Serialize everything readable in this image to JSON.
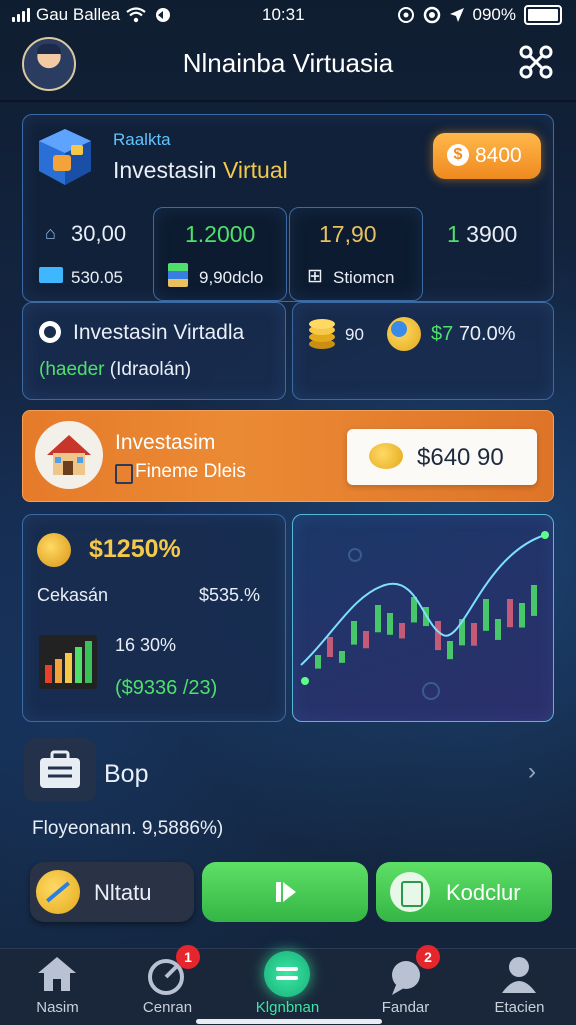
{
  "status_bar": {
    "carrier": "Gau Ballea",
    "time": "10:31",
    "battery": "090%"
  },
  "header": {
    "title": "Nlnainba Virtuasia"
  },
  "main_card": {
    "small_label": "Raalkta",
    "title_white": "Investasin ",
    "title_yellow": "Virtual",
    "badge_value": "8400",
    "stat1": "30,00",
    "stat2": "1.2000",
    "stat3": "17,90",
    "stat4": "1 3900",
    "sub1": "530.05",
    "sub2": "9,90dclo",
    "sub3": "Stiomcn"
  },
  "invest_card": {
    "title": "Investasin Virtadla",
    "sub_green": "(haeder",
    "sub_white": " (Idraolán)"
  },
  "coin_card": {
    "value1": "90",
    "value2": "$7 70.0%"
  },
  "orange_banner": {
    "title": "Investasim",
    "subtitle": "Fineme Dleis",
    "price": "$640 90"
  },
  "left_panel": {
    "amount": "$1250%",
    "label": "Cekasán",
    "label_value": "$535.%",
    "mid": "16 30%",
    "bottom": "($9336 /23)"
  },
  "section": {
    "title": "Bop",
    "subtitle": "Floyeonann. 9,5886%)"
  },
  "buttons": {
    "b1": "Nltatu",
    "b3": "Kodclur"
  },
  "nav": [
    {
      "label": "Nasim"
    },
    {
      "label": "Cenran",
      "badge": "1"
    },
    {
      "label": "Klgnbnan"
    },
    {
      "label": "Fandar",
      "badge": "2"
    },
    {
      "label": "Etacien"
    }
  ],
  "colors": {
    "accent_green": "#4ee06a",
    "accent_orange": "#e57b2a",
    "accent_yellow": "#f4c94a",
    "card_border": "#3c6aa3"
  }
}
